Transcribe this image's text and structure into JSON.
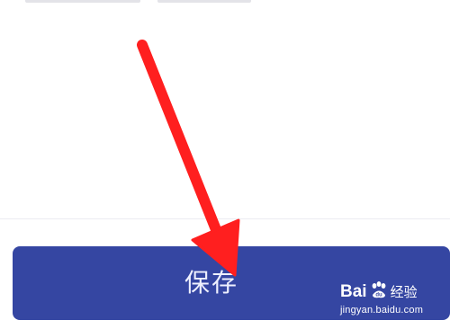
{
  "footer": {
    "save_label": "保存"
  },
  "watermark": {
    "brand_left": "Bai",
    "brand_right": "经验",
    "url": "jingyan.baidu.com"
  },
  "colors": {
    "button_bg": "#3546a2",
    "arrow": "#ff1f1f",
    "background": "#ffffff"
  },
  "icons": {
    "annotation": "red-arrow-icon",
    "watermark_logo": "baidu-paw-icon"
  }
}
